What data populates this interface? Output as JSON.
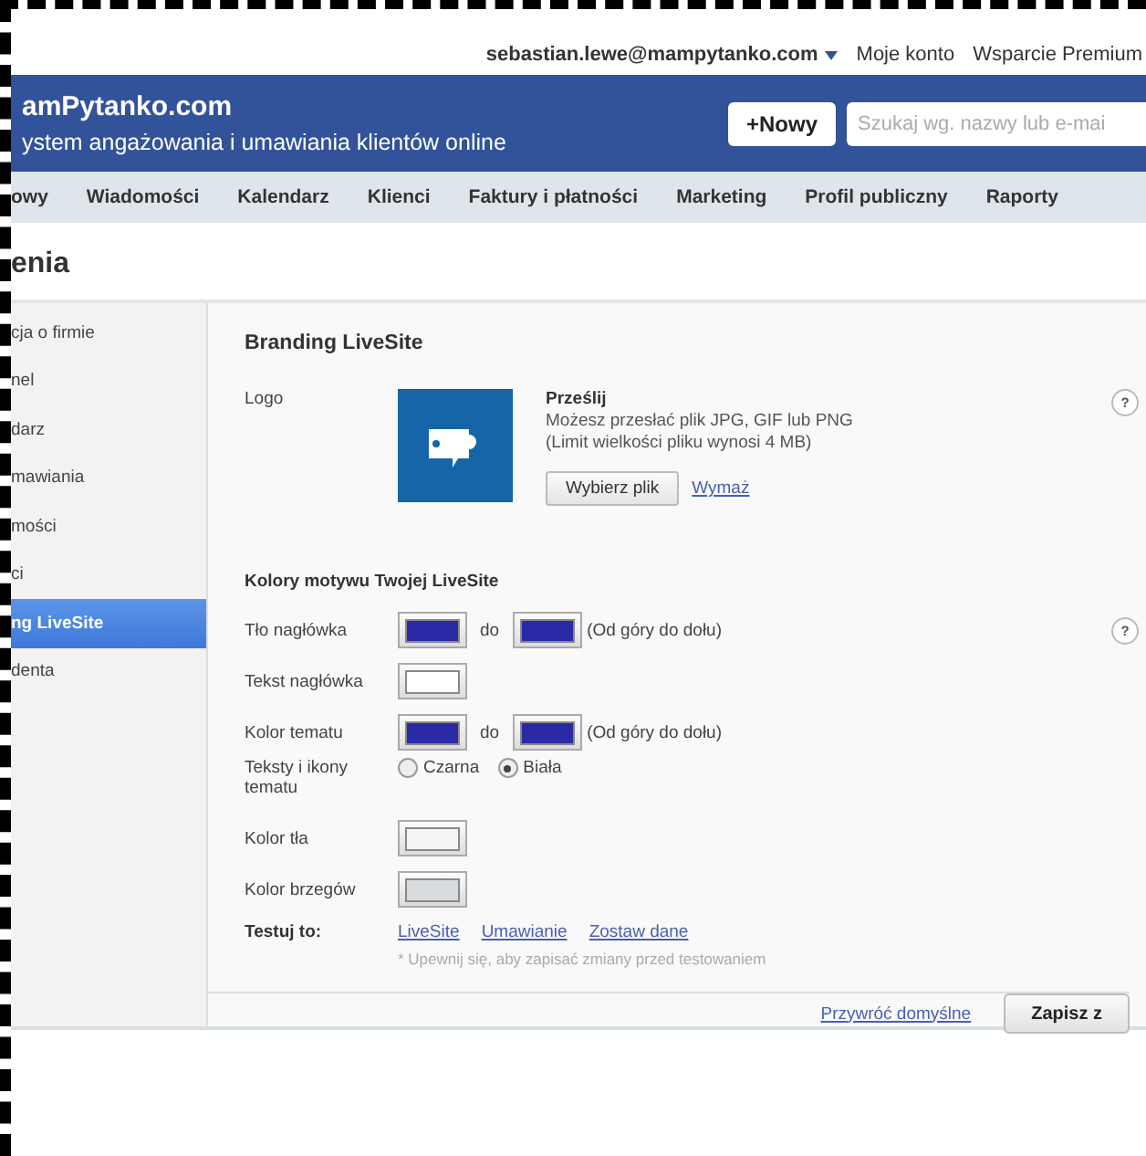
{
  "account_bar": {
    "email": "sebastian.lewe@mampytanko.com",
    "links": [
      "Moje konto",
      "Wsparcie Premium"
    ]
  },
  "header": {
    "brand": "amPytanko.com",
    "tagline": "ystem angażowania i umawiania klientów online",
    "new_button": "+Nowy",
    "search": {
      "placeholder": "Szukaj wg. nazwy lub e-mai"
    }
  },
  "nav": {
    "items": [
      "owy",
      "Wiadomości",
      "Kalendarz",
      "Klienci",
      "Faktury i płatności",
      "Marketing",
      "Profil publiczny",
      "Raporty"
    ]
  },
  "page_title": "enia",
  "sidebar": {
    "items": [
      {
        "label": "cja o firmie",
        "selected": false
      },
      {
        "label": "nel",
        "selected": false
      },
      {
        "label": "darz",
        "selected": false
      },
      {
        "label": "mawiania",
        "selected": false
      },
      {
        "label": "mości",
        "selected": false
      },
      {
        "label": "ci",
        "selected": false
      },
      {
        "label": "ng LiveSite",
        "selected": true
      },
      {
        "label": "denta",
        "selected": false
      }
    ]
  },
  "branding": {
    "title": "Branding LiveSite",
    "logo": {
      "label": "Logo",
      "upload_title": "Prześlij",
      "upload_hint": "Możesz przesłać plik JPG, GIF lub PNG",
      "size_hint": "(Limit wielkości pliku wynosi 4 MB)",
      "choose_button": "Wybierz plik",
      "remove_link": "Wymaż",
      "help": "?"
    },
    "theme": {
      "title": "Kolory motywu Twojej LiveSite",
      "rows": [
        {
          "kind": "gradient",
          "label": "Tło nagłówka",
          "swatches": [
            {
              "color": "#2a2aa6"
            },
            {
              "color": "#2a2aa6"
            }
          ],
          "joiner": "do",
          "note": "(Od góry do dołu)",
          "help": "?"
        },
        {
          "kind": "color",
          "label": "Tekst nagłówka",
          "color": "#ffffff"
        },
        {
          "kind": "gradient",
          "label": "Kolor tematu",
          "swatches": [
            {
              "color": "#2a2aa6"
            },
            {
              "color": "#2a2aa6"
            }
          ],
          "joiner": "do",
          "note": "(Od góry do dołu)"
        },
        {
          "kind": "radio",
          "label": "Teksty i ikony tematu",
          "options": [
            {
              "label": "Czarna",
              "selected": false
            },
            {
              "label": "Biała",
              "selected": true
            }
          ]
        },
        {
          "kind": "color",
          "label": "Kolor tła",
          "color": "#f4f4f4"
        },
        {
          "kind": "color",
          "label": "Kolor brzegów",
          "color": "#d8dcdf"
        }
      ]
    },
    "test": {
      "label": "Testuj to:",
      "links": [
        "LiveSite",
        "Umawianie",
        "Zostaw dane"
      ],
      "note": "* Upewnij się, aby zapisać zmiany przed testowaniem"
    }
  },
  "footer": {
    "reset_link": "Przywróć domyślne",
    "save_button": "Zapisz z"
  }
}
